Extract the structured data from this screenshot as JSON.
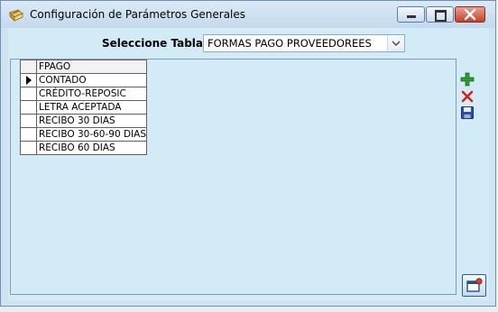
{
  "window": {
    "title": "Configuración de Parámetros Generales"
  },
  "form": {
    "table_label": "Seleccione Tabla:",
    "table_value": "FORMAS PAGO PROVEEDOREES"
  },
  "grid": {
    "column_header": "FPAGO",
    "rows": [
      "CONTADO",
      "CRÉDITO-REPOSIC",
      "LETRA ACEPTADA",
      "RECIBO 30 DIAS",
      "RECIBO 30-60-90 DIAS",
      "RECIBO 60 DIAS"
    ],
    "current_row": 0
  },
  "icons": {
    "app": "notebook-pencil-icon",
    "add": "add-icon",
    "delete": "delete-icon",
    "save": "save-icon",
    "exit": "exit-icon"
  },
  "colors": {
    "client_bg": "#d3ebf7",
    "add_green": "#2f9a2f",
    "delete_red": "#d22020",
    "save_blue": "#2b4ea6"
  }
}
